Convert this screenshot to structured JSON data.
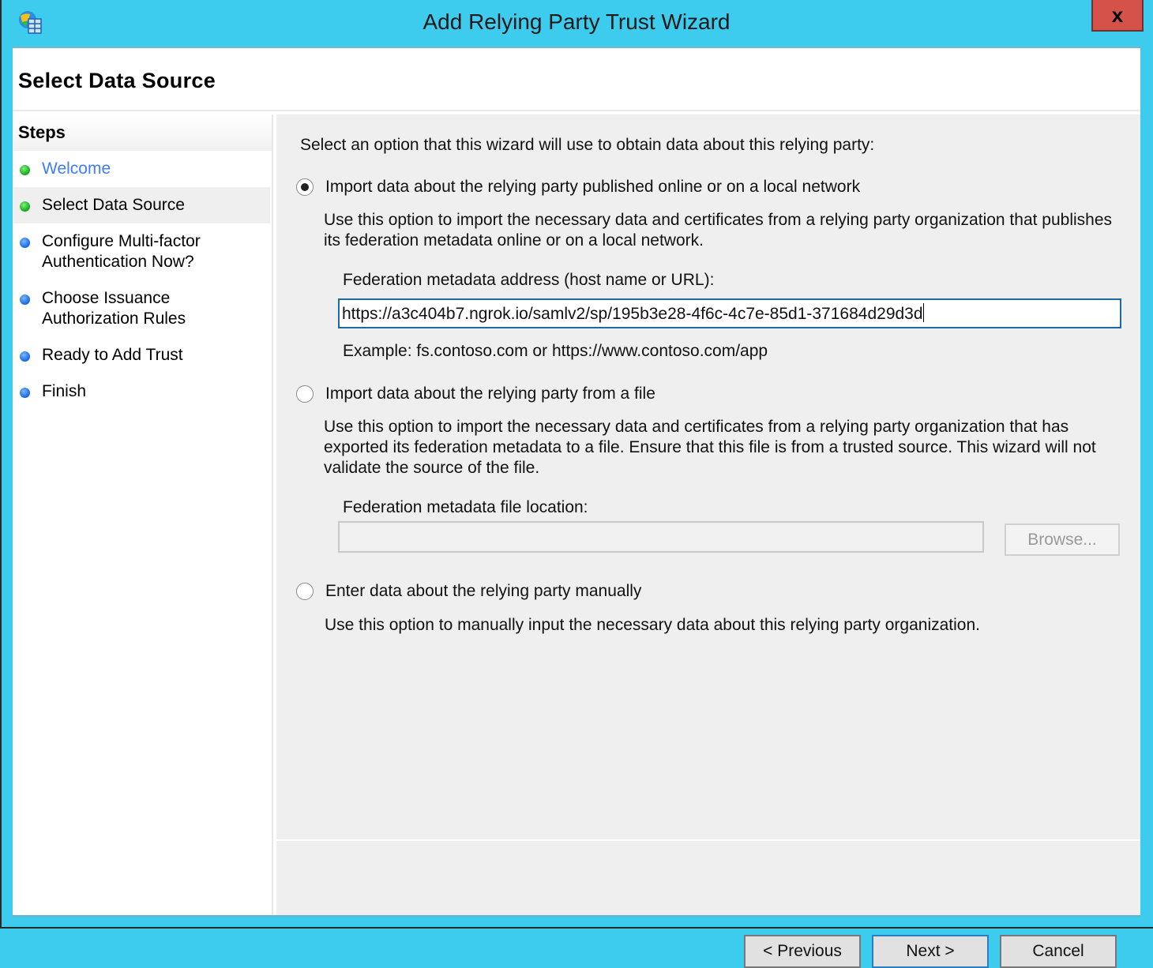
{
  "window": {
    "title": "Add Relying Party Trust Wizard",
    "close_label": "x",
    "app_icon": "adfs-management-icon"
  },
  "header": {
    "page_title": "Select Data Source"
  },
  "steps": {
    "heading": "Steps",
    "items": [
      {
        "label": "Welcome",
        "status": "completed",
        "dot_color": "#22b02a",
        "is_link": true
      },
      {
        "label": "Select Data Source",
        "status": "current",
        "dot_color": "#22b02a"
      },
      {
        "label": "Configure Multi-factor Authentication Now?",
        "line1": "Configure Multi-factor",
        "line2": "Authentication Now?",
        "status": "pending",
        "dot_color": "#1f6fe6"
      },
      {
        "label": "Choose Issuance Authorization Rules",
        "line1": "Choose Issuance",
        "line2": "Authorization Rules",
        "status": "pending",
        "dot_color": "#1f6fe6"
      },
      {
        "label": "Ready to Add Trust",
        "status": "pending",
        "dot_color": "#1f6fe6"
      },
      {
        "label": "Finish",
        "status": "pending",
        "dot_color": "#1f6fe6"
      }
    ]
  },
  "main": {
    "intro": "Select an option that this wizard will use to obtain data about this relying party:",
    "options": [
      {
        "label": "Import data about the relying party published online or on a local network",
        "selected": true,
        "desc_line1": "Use this option to import the necessary data and certificates from a relying party organization that publishes",
        "desc_line2": "its federation metadata online or on a local network."
      },
      {
        "label": "Import data about the relying party from a file",
        "selected": false,
        "desc_line1": "Use this option to import the necessary data and certificates from a relying party organization that has",
        "desc_line2": "exported its federation metadata to a file. Ensure that this file is from a trusted source.  This wizard will not",
        "desc_line3": "validate the source of the file."
      },
      {
        "label": "Enter data about the relying party manually",
        "selected": false,
        "desc_line1": "Use this option to manually input the necessary data about this relying party organization."
      }
    ],
    "metadata_address": {
      "label": "Federation metadata address (host name or URL):",
      "value": "https://a3c404b7.ngrok.io/samlv2/sp/195b3e28-4f6c-4c7e-85d1-371684d29d3d",
      "example": "Example: fs.contoso.com or https://www.contoso.com/app"
    },
    "metadata_file": {
      "label": "Federation metadata file location:",
      "value": "",
      "browse_label": "Browse...",
      "enabled": false
    }
  },
  "footer": {
    "previous_label": "< Previous",
    "next_label": "Next >",
    "cancel_label": "Cancel"
  }
}
